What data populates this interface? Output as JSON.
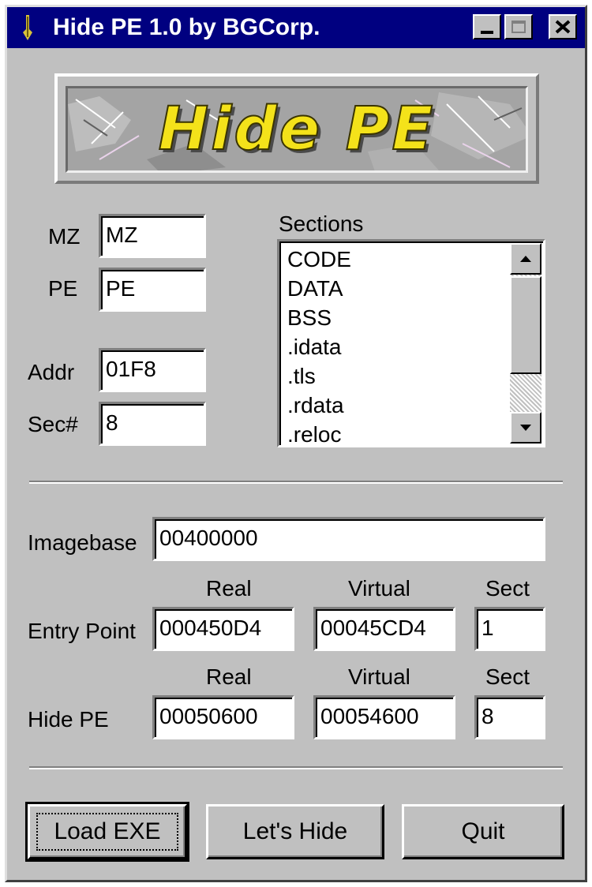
{
  "window": {
    "title": "Hide PE 1.0 by BGCorp."
  },
  "banner": {
    "text": "Hide PE"
  },
  "header": {
    "mz_label": "MZ",
    "mz_value": "MZ",
    "pe_label": "PE",
    "pe_value": "PE",
    "addr_label": "Addr",
    "addr_value": "01F8",
    "secnum_label": "Sec#",
    "secnum_value": "8"
  },
  "sections": {
    "label": "Sections",
    "items": [
      "CODE",
      "DATA",
      "BSS",
      ".idata",
      ".tls",
      ".rdata",
      ".reloc"
    ]
  },
  "imagebase": {
    "label": "Imagebase",
    "value": "00400000"
  },
  "columns": {
    "real": "Real",
    "virtual": "Virtual",
    "sect": "Sect"
  },
  "entry_point": {
    "label": "Entry Point",
    "real": "000450D4",
    "virtual": "00045CD4",
    "sect": "1"
  },
  "hide_pe": {
    "label": "Hide PE",
    "real": "00050600",
    "virtual": "00054600",
    "sect": "8"
  },
  "buttons": {
    "load": "Load EXE",
    "hide": "Let's Hide",
    "quit": "Quit"
  },
  "colors": {
    "titlebar": "#000080",
    "face": "#c0c0c0",
    "banner_text": "#f4e21a"
  }
}
